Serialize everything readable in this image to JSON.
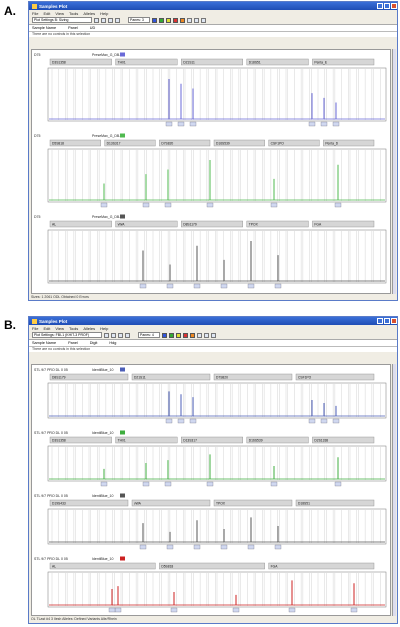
{
  "panel_a_letter": "A.",
  "panel_b_letter": "B.",
  "panel_a": {
    "window_title": "Samples Plot",
    "menu": [
      "File",
      "Edit",
      "View",
      "Tools",
      "Alleles",
      "Help"
    ],
    "toolbar": {
      "preset": "Plot Settings B: Sizing",
      "panes": "Panes: 3"
    },
    "info": {
      "sample_name": "Sample Name",
      "panel": "Panel",
      "ud": "UD"
    },
    "notice": "There are no controls in this selection",
    "status": "Sizes: 1 2061 ODL Obtained 0 Errors",
    "rows": [
      {
        "label": "D75",
        "sample": "PreseMax_G_DB-7",
        "color": "#6a6ad8",
        "markers": [
          "D3S1358",
          "TH01",
          "D21S11",
          "D18S51",
          "Penta_E"
        ]
      },
      {
        "label": "D75",
        "sample": "PreseMax_G_DB-7",
        "color": "#4fb94f",
        "markers": [
          "D5S818",
          "D13S317",
          "D7S820",
          "D16S539",
          "CSF1PO",
          "Penta_D"
        ]
      },
      {
        "label": "D75",
        "sample": "PreseMax_G_DB-7",
        "color": "#555555",
        "markers": [
          "AL",
          "vWA",
          "D8S1179",
          "TPOX",
          "FGA"
        ]
      }
    ]
  },
  "panel_b": {
    "window_title": "Samples Plot",
    "menu": [
      "File",
      "Edit",
      "View",
      "Tools",
      "Alleles",
      "Help"
    ],
    "toolbar": {
      "preset": "Plot Settings: FBI-1 (KHIT-3 PROF)",
      "panes": "Panes: 4"
    },
    "info": {
      "sample_name": "Sample Name",
      "panel": "Panel",
      "ud": "Digit",
      "ud2": "Hdg"
    },
    "notice": "There are no controls in this selection",
    "status": "OL TLast #4  3 Ilesh Alleles: Defined Variants Alle/Rhein",
    "rows": [
      {
        "label": "STL 9/7 PRO DL 0 05",
        "sample": "IdentiBlue_10",
        "color": "#4d5fb8",
        "markers": [
          "D8S1179",
          "D21S11",
          "D7S820",
          "CSF1PO"
        ]
      },
      {
        "label": "STL 9/7 PRO DL 0 05",
        "sample": "IdentiBlue_10",
        "color": "#3fae3f",
        "markers": [
          "D3S1358",
          "TH01",
          "D13S317",
          "D16S539",
          "D2S1338"
        ]
      },
      {
        "label": "STL 9/7 PRO DL 0 05",
        "sample": "IdentiBlue_10",
        "color": "#555555",
        "markers": [
          "D19S433",
          "vWA",
          "TPOX",
          "D18S51"
        ]
      },
      {
        "label": "STL 9/7 PRO DL 0 05",
        "sample": "IdentiBlue_10",
        "color": "#cc2222",
        "markers": [
          "AL",
          "D5S818",
          "FGA"
        ]
      }
    ]
  }
}
